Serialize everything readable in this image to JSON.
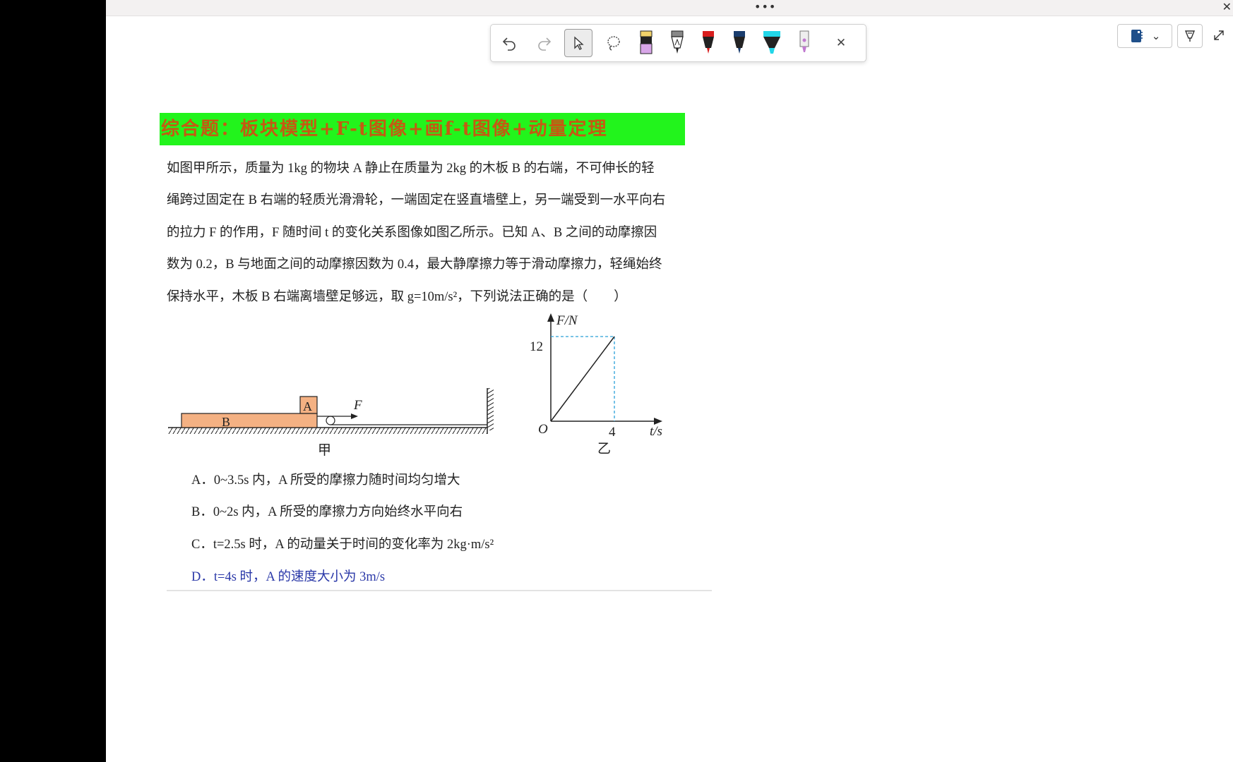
{
  "top_bar": {
    "more_label": "•••",
    "close_label": "✕"
  },
  "toolbar": {
    "close_label": "✕",
    "tools": [
      "undo-icon",
      "redo-icon",
      "select-cursor-icon",
      "lasso-icon",
      "pen-pink-icon",
      "pen-black-text-icon",
      "pen-red-icon",
      "pen-navy-icon",
      "highlighter-cyan-icon",
      "eraser-pen-icon"
    ]
  },
  "right_controls": {
    "notebook_chevron": "⌄",
    "touch_icon": "touch-draw-icon",
    "expand_icon": "expand-icon"
  },
  "colors": {
    "banner_bg": "#22f41c",
    "banner_text": "#c45a12",
    "answer_blue": "#2a38a8",
    "block_fill": "#f4b183",
    "dashed_line": "#2aa0d8"
  },
  "title": "综合题：板块模型+F-t图像+画f-t图像+动量定理",
  "question": {
    "lines": [
      "如图甲所示，质量为 1kg 的物块 A 静止在质量为 2kg 的木板 B 的右端，不可伸长的轻",
      "绳跨过固定在 B 右端的轻质光滑滑轮，一端固定在竖直墙壁上，另一端受到一水平向右",
      "的拉力 F 的作用，F 随时间 t 的变化关系图像如图乙所示。已知 A、B 之间的动摩擦因",
      "数为 0.2，B 与地面之间的动摩擦因数为 0.4，最大静摩擦力等于滑动摩擦力，轻绳始终",
      "保持水平，木板 B 右端离墙壁足够远，取 g=10m/s²，下列说法正确的是（　　）"
    ]
  },
  "figure_jia": {
    "caption": "甲",
    "label_a": "A",
    "label_b": "B",
    "label_f": "F"
  },
  "figure_yi": {
    "caption": "乙",
    "y_axis_label": "F/N",
    "x_axis_label": "t/s",
    "origin_label": "O",
    "y_tick": "12",
    "x_tick": "4"
  },
  "chart_data": {
    "type": "line",
    "x": [
      0,
      4
    ],
    "y": [
      0,
      12
    ],
    "xlabel": "t/s",
    "ylabel": "F/N",
    "xlim": [
      0,
      4
    ],
    "ylim": [
      0,
      12
    ]
  },
  "options": [
    {
      "letter": "A．",
      "text": "0~3.5s 内，A 所受的摩擦力随时间均匀增大"
    },
    {
      "letter": "B．",
      "text": "0~2s 内，A 所受的摩擦力方向始终水平向右"
    },
    {
      "letter": "C．",
      "text": "t=2.5s 时，A 的动量关于时间的变化率为 2kg·m/s²"
    },
    {
      "letter": "D．",
      "text": "t=4s 时，A 的速度大小为 3m/s"
    }
  ]
}
